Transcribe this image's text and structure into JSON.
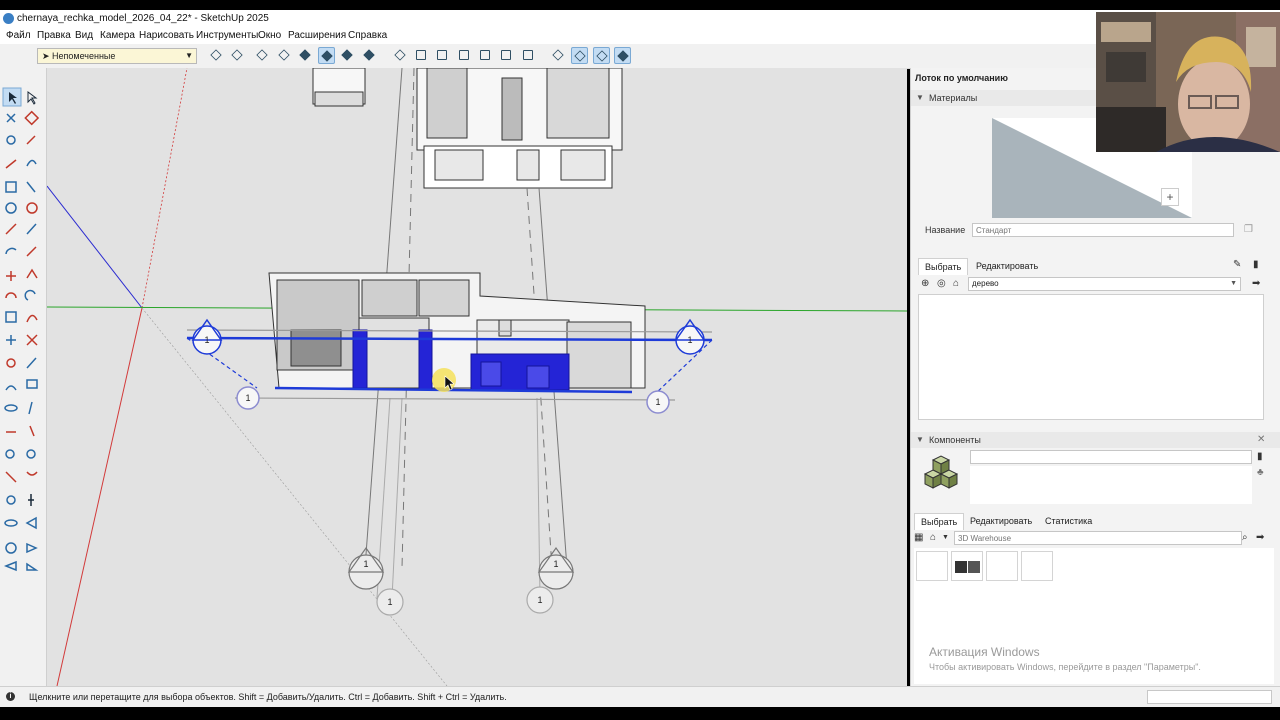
{
  "window": {
    "title": "chernaya_rechka_model_2026_04_22* - SketchUp 2025"
  },
  "menu": [
    "Файл",
    "Правка",
    "Вид",
    "Камера",
    "Нарисовать",
    "Инструменты",
    "Окно",
    "Расширения",
    "Справка"
  ],
  "toolbar": {
    "tag_selector": "Непомеченные"
  },
  "tray": {
    "title": "Лоток по умолчанию",
    "materials": {
      "header": "Материалы",
      "name_label": "Название",
      "name_placeholder": "Стандарт",
      "tabs": [
        "Выбрать",
        "Редактировать"
      ],
      "library": "дерево"
    },
    "components": {
      "header": "Компоненты",
      "tabs": [
        "Выбрать",
        "Редактировать",
        "Статистика"
      ],
      "search_placeholder": "3D Warehouse"
    },
    "activation": {
      "line1": "Активация Windows",
      "line2": "Чтобы активировать Windows, перейдите в раздел \"Параметры\"."
    }
  },
  "viewport": {
    "section_marker": "1"
  },
  "status": {
    "message": "Щелкните или перетащите для выбора объектов. Shift = Добавить/Удалить. Ctrl = Добавить. Shift + Ctrl = Удалить."
  },
  "colors": {
    "accent": "#1e3bd8",
    "axis_red": "#d23a3a",
    "axis_green": "#2aa52a",
    "axis_blue": "#2b2bd0",
    "tag_bg": "#fbf6d6"
  }
}
